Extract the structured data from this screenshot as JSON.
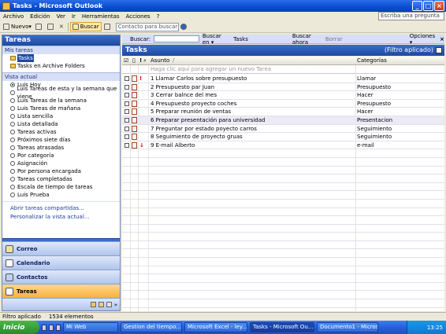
{
  "window": {
    "title": "Tasks - Microsoft Outlook"
  },
  "menu": [
    "Archivo",
    "Edición",
    "Ver",
    "Ir",
    "Herramientas",
    "Acciones",
    "?"
  ],
  "ask": "Escriba una pregunta",
  "toolbar": {
    "new_label": "Nuevo",
    "search_label": "Buscar",
    "contact_placeholder": "Contacto para buscar"
  },
  "nav": {
    "title": "Tareas",
    "my_tasks_header": "Mis tareas",
    "folders": [
      "Tasks",
      "Tasks en Archive Folders"
    ],
    "view_header": "Vista actual",
    "views": [
      "Luis Hoy",
      "Luis Tareas de esta y la semana que viene",
      "Luis Tareas de la semana",
      "Luis Tareas de mañana",
      "Lista sencilla",
      "Lista detallada",
      "Tareas activas",
      "Próximos siete días",
      "Tareas atrasadas",
      "Por categoría",
      "Asignación",
      "Por persona encargada",
      "Tareas completadas",
      "Escala de tiempo de tareas",
      "Luis Prueba"
    ],
    "links": [
      "Abrir tareas compartidas...",
      "Personalizar la vista actual..."
    ],
    "panes": [
      "Correo",
      "Calendario",
      "Contactos",
      "Tareas"
    ]
  },
  "find": {
    "buscar": "Buscar:",
    "buscar_en": "Buscar en",
    "buscar_en_value": "Tasks",
    "buscar_ahora": "Buscar ahora",
    "borrar": "Borrar",
    "opciones": "Opciones"
  },
  "main": {
    "title": "Tasks",
    "filter": "(Filtro aplicado)",
    "col_subject": "Asunto",
    "col_category": "Categorías",
    "new_row": "Haga clic aquí para agregar un nuevo Tarea",
    "tasks": [
      {
        "subject": "1 Llamar Carlos sobre presupuesto",
        "category": "Llamar",
        "importance": "!"
      },
      {
        "subject": "2 Presupuesto par Juan",
        "category": "Presupuesto",
        "importance": ""
      },
      {
        "subject": "3 Cerrar balnce del mes",
        "category": "Hacer",
        "importance": ""
      },
      {
        "subject": "4 Presupuesto proyecto coches",
        "category": "Presupuesto",
        "importance": ""
      },
      {
        "subject": "5 Preparar reunión de ventas",
        "category": "Hacer",
        "importance": ""
      },
      {
        "subject": "6 Preparar presentación para universidad",
        "category": "Presentacion",
        "importance": ""
      },
      {
        "subject": "7 Preguntar por estado poyecto carros",
        "category": "Seguimiento",
        "importance": ""
      },
      {
        "subject": "8 Seguimiento de proyecto gruas",
        "category": "Seguimiento",
        "importance": ""
      },
      {
        "subject": "9 E-mail Alberto",
        "category": "e-mail",
        "importance": "↓"
      }
    ]
  },
  "status": {
    "filter": "Filtro aplicado",
    "count": "1534 elementos"
  },
  "taskbar": {
    "start": "Inicio",
    "items": [
      "Mi Web",
      "Gestion del tiempo....",
      "Microsoft Excel - ley...",
      "Tasks - Microsoft Ou...",
      "Documento1 - Micros..."
    ],
    "clock": "13:25"
  }
}
